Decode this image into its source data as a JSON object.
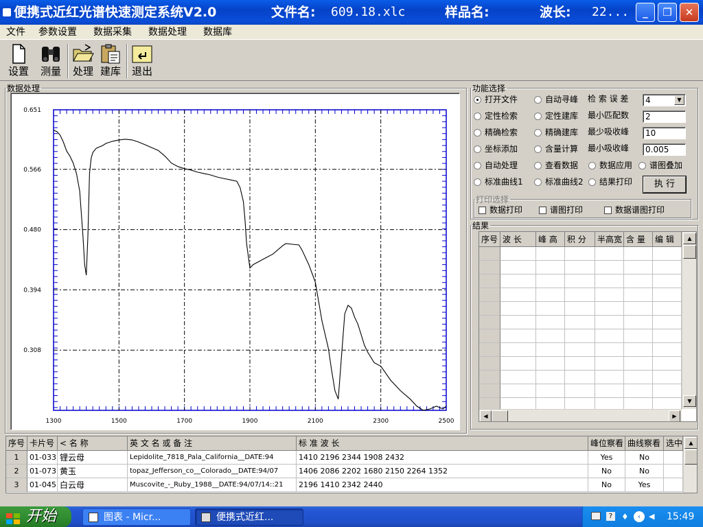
{
  "window": {
    "title": "便携式近红光谱快速测定系统V2.0",
    "file_label": "文件名:",
    "file_value": "609.18.xlc",
    "sample_label": "样品名:",
    "wave_label": "波长:",
    "wave_value": "22..."
  },
  "menu": [
    "文件",
    "参数设置",
    "数据采集",
    "数据处理",
    "数据库"
  ],
  "toolbar": [
    "设置",
    "测量",
    "处理",
    "建库",
    "退出"
  ],
  "chart_group_title": "数据处理",
  "chart_data": {
    "type": "line",
    "title": "",
    "xlabel": "",
    "ylabel": "",
    "xlim": [
      1300,
      2500
    ],
    "ylim": [
      0.222,
      0.651
    ],
    "xticks": [
      1300,
      1500,
      1700,
      1900,
      2100,
      2300,
      2500
    ],
    "yticks": [
      0.651,
      0.566,
      0.48,
      0.394,
      0.308
    ],
    "ytick_labels": [
      "0.651",
      "0.566",
      "0.480",
      "0.394",
      "0.308"
    ],
    "grid": true,
    "series": [
      {
        "x": [
          1300,
          1310,
          1320,
          1330,
          1340,
          1350,
          1360,
          1370,
          1380,
          1390,
          1395,
          1400,
          1405,
          1410,
          1415,
          1420,
          1430,
          1440,
          1450,
          1460,
          1480,
          1500,
          1520,
          1540,
          1560,
          1580,
          1600,
          1620,
          1640,
          1660,
          1680,
          1700,
          1720,
          1740,
          1760,
          1780,
          1800,
          1820,
          1840,
          1860,
          1870,
          1880,
          1885,
          1890,
          1900,
          1910,
          1930,
          1950,
          1970,
          2000,
          2010,
          2030,
          2050,
          2060,
          2080,
          2100,
          2120,
          2140,
          2150,
          2160,
          2170,
          2180,
          2190,
          2200,
          2210,
          2220,
          2230,
          2240,
          2250,
          2260,
          2280,
          2300,
          2330,
          2360,
          2390,
          2410,
          2430,
          2450,
          2470,
          2490,
          2500
        ],
        "y": [
          0.622,
          0.62,
          0.615,
          0.605,
          0.592,
          0.585,
          0.575,
          0.56,
          0.535,
          0.47,
          0.43,
          0.415,
          0.47,
          0.56,
          0.582,
          0.59,
          0.596,
          0.598,
          0.6,
          0.603,
          0.606,
          0.608,
          0.609,
          0.608,
          0.605,
          0.601,
          0.597,
          0.593,
          0.585,
          0.575,
          0.57,
          0.567,
          0.565,
          0.562,
          0.56,
          0.558,
          0.555,
          0.553,
          0.551,
          0.549,
          0.54,
          0.52,
          0.495,
          0.46,
          0.425,
          0.43,
          0.435,
          0.44,
          0.445,
          0.457,
          0.46,
          0.459,
          0.458,
          0.45,
          0.43,
          0.405,
          0.35,
          0.31,
          0.278,
          0.25,
          0.238,
          0.3,
          0.36,
          0.372,
          0.368,
          0.355,
          0.345,
          0.33,
          0.315,
          0.305,
          0.29,
          0.285,
          0.265,
          0.25,
          0.238,
          0.228,
          0.222,
          0.224,
          0.228,
          0.224,
          0.228
        ]
      }
    ]
  },
  "function_group_title": "功能选择",
  "radios": [
    {
      "label": "打开文件",
      "checked": true
    },
    {
      "label": "自动寻峰",
      "checked": false
    },
    {
      "label": "定性检索",
      "checked": false
    },
    {
      "label": "定性建库",
      "checked": false
    },
    {
      "label": "精确检索",
      "checked": false
    },
    {
      "label": "精确建库",
      "checked": false
    },
    {
      "label": "坐标添加",
      "checked": false
    },
    {
      "label": "含量计算",
      "checked": false
    },
    {
      "label": "自动处理",
      "checked": false
    },
    {
      "label": "查看数据",
      "checked": false
    },
    {
      "label": "数据应用",
      "checked": false
    },
    {
      "label": "谱图叠加",
      "checked": false
    },
    {
      "label": "标准曲线1",
      "checked": false
    },
    {
      "label": "标准曲线2",
      "checked": false
    },
    {
      "label": "结果打印",
      "checked": false
    }
  ],
  "params": [
    {
      "label": "检 索 误 差",
      "value": "4"
    },
    {
      "label": "最小匹配数",
      "value": "2"
    },
    {
      "label": "最少吸收峰",
      "value": "10"
    },
    {
      "label": "最小吸收峰",
      "value": "0.005"
    }
  ],
  "execute_label": "执  行",
  "print_group_title": "打印选择",
  "print_options": [
    "数据打印",
    "谱图打印",
    "数据谱图打印"
  ],
  "result_group_title": "结果",
  "result_headers": [
    "序号",
    "波    长",
    "峰 高",
    "积 分",
    "半高宽",
    "含 量",
    "编 辑"
  ],
  "table_headers": [
    "序号",
    "卡片号",
    "< 名    称",
    "英  文   名   或  备  注",
    "标          准          波          长",
    "峰位察看",
    "曲线察看",
    "选中"
  ],
  "table_rows": [
    {
      "no": "1",
      "card": "01-033",
      "name": "锂云母",
      "note": "Lepidolite_7818_Pala_California__DATE:94",
      "waves": "1410   2196   2344   1908   2432",
      "peak": "Yes",
      "curve": "No"
    },
    {
      "no": "2",
      "card": "01-073",
      "name": "黄玉",
      "note": "topaz_Jefferson_co__Colorado__DATE:94/07",
      "waves": "1406   2086   2202   1680   2150   2264   1352",
      "peak": "No",
      "curve": "No"
    },
    {
      "no": "3",
      "card": "01-045",
      "name": "白云母",
      "note": "Muscovite_-_Ruby_1988__DATE:94/07/14::21",
      "waves": "2196   1410   2342   2440",
      "peak": "No",
      "curve": "Yes"
    }
  ],
  "taskbar": {
    "start": "开始",
    "items": [
      "图表 - Micr...",
      "便携式近红..."
    ],
    "clock": "15:49"
  }
}
